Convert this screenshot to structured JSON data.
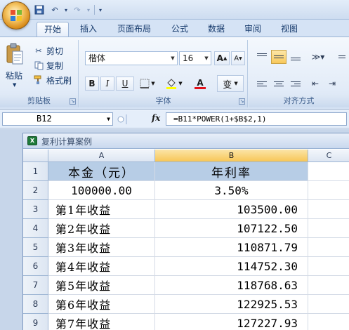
{
  "ribbon": {
    "tabs": [
      "开始",
      "插入",
      "页面布局",
      "公式",
      "数据",
      "审阅",
      "视图"
    ],
    "clipboard": {
      "paste": "粘贴",
      "cut": "剪切",
      "copy": "复制",
      "format_painter": "格式刷",
      "label": "剪贴板"
    },
    "font": {
      "name": "楷体",
      "size": "16",
      "grow": "A",
      "shrink": "A",
      "bold": "B",
      "italic": "I",
      "underline": "U",
      "font_color_letter": "A",
      "phonetic": "变",
      "label": "字体"
    },
    "alignment": {
      "label": "对齐方式"
    }
  },
  "formula_bar": {
    "name_box": "B12",
    "fx": "fx",
    "formula": "=B11*POWER(1+$B$2,1)"
  },
  "workbook": {
    "title": "复利计算案例",
    "columns": [
      "A",
      "B",
      "C"
    ],
    "rows": [
      {
        "n": "1",
        "a": "本金（元）",
        "b": "年利率"
      },
      {
        "n": "2",
        "a": "100000.00",
        "b": "3.50%"
      },
      {
        "n": "3",
        "a": "第1年收益",
        "b": "103500.00"
      },
      {
        "n": "4",
        "a": "第2年收益",
        "b": "107122.50"
      },
      {
        "n": "5",
        "a": "第3年收益",
        "b": "110871.79"
      },
      {
        "n": "6",
        "a": "第4年收益",
        "b": "114752.30"
      },
      {
        "n": "7",
        "a": "第5年收益",
        "b": "118768.63"
      },
      {
        "n": "8",
        "a": "第6年收益",
        "b": "122925.53"
      },
      {
        "n": "9",
        "a": "第7年收益",
        "b": "127227.93"
      }
    ]
  },
  "colors": {
    "selected_column_header": "#f7c657",
    "header_fill": "#b7cde6",
    "ribbon_bg": "#e3ecf8"
  }
}
